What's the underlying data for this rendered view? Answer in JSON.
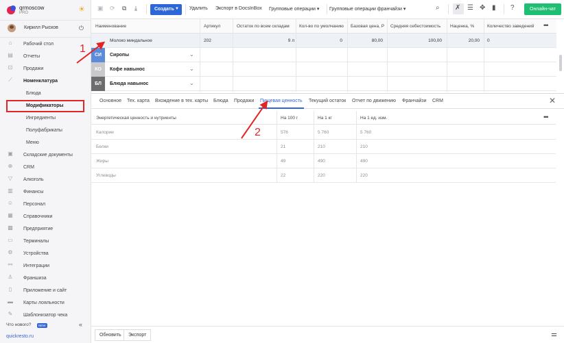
{
  "brand": {
    "name": "qrmoscow",
    "tier": "PRO"
  },
  "user": {
    "name": "Кирилл Рысков"
  },
  "sidebar": {
    "items": [
      {
        "icon": "⌂",
        "label": "Рабочий стол"
      },
      {
        "icon": "▤",
        "label": "Отчеты"
      },
      {
        "icon": "⊡",
        "label": "Продажи"
      },
      {
        "icon": "⟋",
        "label": "Номенклатура"
      },
      {
        "label": "Блюда"
      },
      {
        "label": "Модификаторы"
      },
      {
        "label": "Ингредиенты"
      },
      {
        "label": "Полуфабрикаты"
      },
      {
        "label": "Меню"
      },
      {
        "icon": "▣",
        "label": "Складские документы"
      },
      {
        "icon": "⊕",
        "label": "CRM"
      },
      {
        "icon": "▽",
        "label": "Алкоголь"
      },
      {
        "icon": "▥",
        "label": "Финансы"
      },
      {
        "icon": "☺",
        "label": "Персонал"
      },
      {
        "icon": "▦",
        "label": "Справочники"
      },
      {
        "icon": "▩",
        "label": "Предприятие"
      },
      {
        "icon": "▭",
        "label": "Терминалы"
      },
      {
        "icon": "⚙",
        "label": "Устройства"
      },
      {
        "icon": "⚯",
        "label": "Интеграции"
      },
      {
        "icon": "♙",
        "label": "Франшиза"
      },
      {
        "icon": "▯",
        "label": "Приложение и сайт"
      },
      {
        "icon": "▬",
        "label": "Карты лояльности"
      },
      {
        "icon": "✎",
        "label": "Шаблонизатор чека"
      }
    ],
    "whats_new": "Что нового?",
    "new_badge": "NEW",
    "site_link": "quickresto.ru"
  },
  "toolbar": {
    "create": "Создать",
    "delete": "Удалить",
    "export_docsinbox": "Экспорт в DocsInBox",
    "group_ops": "Групповые операции",
    "group_ops_franchise": "Групповые операции франчайзи",
    "chat": "Онлайн-чат"
  },
  "table": {
    "columns": [
      "Наименование",
      "Артикул",
      "Остаток по всем складам",
      "Кол-во по умолчанию",
      "Базовая цена, Р",
      "Средняя себестоимость",
      "Наценка, %",
      "Количество заведений"
    ],
    "selected_row": {
      "name": "Молоко миндальное",
      "article": "202",
      "stock": "9 л",
      "default_qty": "0",
      "base_price": "80,00",
      "avg_cost": "100,00",
      "markup": "20,00",
      "venues": "0"
    },
    "groups": [
      {
        "abbr": "СИ",
        "name": "Сиропы",
        "color": "#5b8bd9"
      },
      {
        "abbr": "КО",
        "name": "Кофе навынос",
        "color": "#c9c9cc"
      },
      {
        "abbr": "БЛ",
        "name": "Блюда навынос",
        "color": "#6d6d70"
      }
    ]
  },
  "detail": {
    "tabs": [
      "Основное",
      "Тех. карта",
      "Вхождение в тех. карты",
      "Блюда",
      "Продажи",
      "Пищевая ценность",
      "Текущий остаток",
      "Отчет по движению",
      "Франчайзи",
      "CRM"
    ],
    "active_tab": "Пищевая ценность",
    "nutrition": {
      "headers": [
        "Энергетическая ценность и нутриенты",
        "На 100 г",
        "На 1 кг",
        "На 1 ед. изм."
      ],
      "rows": [
        {
          "name": "Калории",
          "per100": "576",
          "per1kg": "5 760",
          "perUnit": "5 760"
        },
        {
          "name": "Белки",
          "per100": "21",
          "per1kg": "210",
          "perUnit": "210"
        },
        {
          "name": "Жиры",
          "per100": "49",
          "per1kg": "490",
          "perUnit": "490"
        },
        {
          "name": "Углеводы",
          "per100": "22",
          "per1kg": "220",
          "perUnit": "220"
        }
      ]
    }
  },
  "footer": {
    "refresh": "Обновить",
    "export": "Экспорт"
  },
  "annotations": {
    "step1": "1",
    "step2": "2",
    "color": "#e02525"
  }
}
